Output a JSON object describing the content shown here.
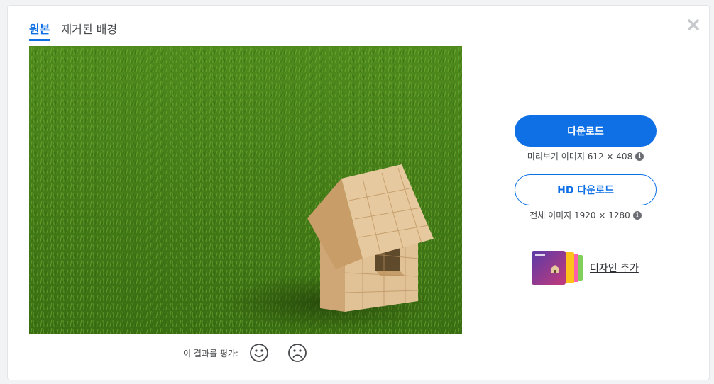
{
  "tabs": {
    "original_label": "원본",
    "removed_bg_label": "제거된 배경"
  },
  "download": {
    "label": "다운로드",
    "preview_info": "미리보기 이미지 612 × 408"
  },
  "hd_download": {
    "label": "HD 다운로드",
    "full_info": "전체 이미지 1920 × 1280"
  },
  "design": {
    "label": "디자인 추가"
  },
  "rating": {
    "label": "이 결과를 평가:"
  },
  "colors": {
    "accent": "#0f70e6",
    "text": "#45474a",
    "grass": "#4f8a1e",
    "wood": "#d9b88a"
  },
  "icons": {
    "close": "close-icon",
    "info": "info-icon",
    "happy": "smiley-face-icon",
    "sad": "frowning-face-icon"
  }
}
